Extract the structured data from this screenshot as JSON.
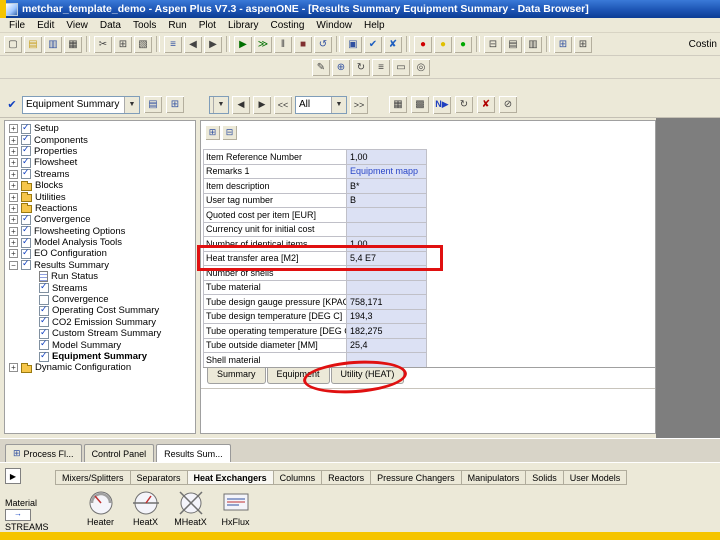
{
  "window": {
    "title": "metchar_template_demo - Aspen Plus V7.3 - aspenONE - [Results Summary Equipment Summary - Data Browser]"
  },
  "menu": {
    "items": [
      "File",
      "Edit",
      "View",
      "Data",
      "Tools",
      "Run",
      "Plot",
      "Library",
      "Costing",
      "Window",
      "Help"
    ]
  },
  "toolbar_main": {
    "overflow_label": "Costin",
    "icons": [
      {
        "name": "new-icon",
        "glyph": "▢"
      },
      {
        "name": "open-icon",
        "glyph": "▤",
        "color": "#c8a020"
      },
      {
        "name": "save-icon",
        "glyph": "▥",
        "color": "#3050a0"
      },
      {
        "name": "print-icon",
        "glyph": "▦",
        "color": "#404040"
      },
      {
        "name": "sep1"
      },
      {
        "name": "cut-icon",
        "glyph": "✂"
      },
      {
        "name": "copy-icon",
        "glyph": "⊞"
      },
      {
        "name": "paste-icon",
        "glyph": "▧"
      },
      {
        "name": "sep2"
      },
      {
        "name": "data-browser-icon",
        "glyph": "≡",
        "color": "#3050a0"
      },
      {
        "name": "prev-form-icon",
        "glyph": "◀"
      },
      {
        "name": "next-form-icon",
        "glyph": "▶"
      },
      {
        "name": "sep3"
      },
      {
        "name": "run-icon",
        "glyph": "▶",
        "color": "#007000"
      },
      {
        "name": "step-icon",
        "glyph": "≫",
        "color": "#007000"
      },
      {
        "name": "pause-icon",
        "glyph": "‖"
      },
      {
        "name": "stop-icon",
        "glyph": "■",
        "color": "#803030"
      },
      {
        "name": "reinitialize-icon",
        "glyph": "↺",
        "color": "#3050a0"
      },
      {
        "name": "sep4"
      },
      {
        "name": "control-panel-icon",
        "glyph": "▣",
        "color": "#3050a0"
      },
      {
        "name": "check-results-icon",
        "glyph": "✔",
        "color": "#2060c0"
      },
      {
        "name": "cancel-run-icon",
        "glyph": "✘",
        "color": "#2060c0"
      },
      {
        "name": "sep5"
      },
      {
        "name": "status-stop-icon",
        "glyph": "●",
        "color": "#d00000"
      },
      {
        "name": "status-wait-icon",
        "glyph": "●",
        "color": "#e0c000"
      },
      {
        "name": "status-go-icon",
        "glyph": "●",
        "color": "#00a800"
      },
      {
        "name": "sep6"
      },
      {
        "name": "flowsheet-icon",
        "glyph": "⊟"
      },
      {
        "name": "history-icon",
        "glyph": "▤"
      },
      {
        "name": "report-icon",
        "glyph": "▥"
      },
      {
        "name": "sep7"
      },
      {
        "name": "costing-grid-icon",
        "glyph": "⊞",
        "color": "#3050a0"
      },
      {
        "name": "summary-table-icon",
        "glyph": "⊞"
      }
    ]
  },
  "toolbar_secondary": {
    "icons": [
      {
        "name": "draw-icon",
        "glyph": "✎"
      },
      {
        "name": "insert-block-icon",
        "glyph": "⊕",
        "color": "#3050a0"
      },
      {
        "name": "rotate-icon",
        "glyph": "↻"
      },
      {
        "name": "align-icon",
        "glyph": "≡"
      },
      {
        "name": "annotate-icon",
        "glyph": "▭"
      },
      {
        "name": "zoom-icon",
        "glyph": "◎"
      }
    ]
  },
  "browser_bar": {
    "check_glyph": "✔",
    "selector_value": "Equipment Summary",
    "filter_value": "All",
    "prev_glyph": "◀",
    "next_glyph": "▶",
    "fast_prev": "<<",
    "fast_next": ">>",
    "next_required": "N▶",
    "icons_left": [
      {
        "name": "sheet-view-icon",
        "glyph": "▤",
        "color": "#3050a0"
      },
      {
        "name": "compare-view-icon",
        "glyph": "⊞",
        "color": "#3050a0"
      }
    ],
    "icons_right": [
      {
        "name": "input-form-icon",
        "glyph": "▦"
      },
      {
        "name": "results-form-icon",
        "glyph": "▩"
      },
      {
        "name": "reconcile-icon",
        "glyph": "↻"
      },
      {
        "name": "delete-icon",
        "glyph": "✘",
        "color": "#b00000"
      },
      {
        "name": "hide-icon",
        "glyph": "⊘"
      }
    ]
  },
  "tree": {
    "items": [
      {
        "label": "Setup",
        "icon": "check",
        "expand": "+"
      },
      {
        "label": "Components",
        "icon": "check",
        "expand": "+"
      },
      {
        "label": "Properties",
        "icon": "check",
        "expand": "+"
      },
      {
        "label": "Flowsheet",
        "icon": "check",
        "expand": "+"
      },
      {
        "label": "Streams",
        "icon": "check",
        "expand": "+"
      },
      {
        "label": "Blocks",
        "icon": "folder",
        "expand": "+"
      },
      {
        "label": "Utilities",
        "icon": "folder",
        "expand": "+"
      },
      {
        "label": "Reactions",
        "icon": "folder",
        "expand": "+"
      },
      {
        "label": "Convergence",
        "icon": "check",
        "expand": "+"
      },
      {
        "label": "Flowsheeting Options",
        "icon": "check",
        "expand": "+"
      },
      {
        "label": "Model Analysis Tools",
        "icon": "check",
        "expand": "+"
      },
      {
        "label": "EO Configuration",
        "icon": "check",
        "expand": "+"
      },
      {
        "label": "Results Summary",
        "icon": "check",
        "expand": "−"
      },
      {
        "label": "Run Status",
        "icon": "sheet",
        "indent": 1
      },
      {
        "label": "Streams",
        "icon": "check",
        "indent": 1
      },
      {
        "label": "Convergence",
        "icon": "empty",
        "indent": 1
      },
      {
        "label": "Operating Cost Summary",
        "icon": "check",
        "indent": 1
      },
      {
        "label": "CO2 Emission Summary",
        "icon": "check",
        "indent": 1
      },
      {
        "label": "Custom Stream Summary",
        "icon": "check",
        "indent": 1
      },
      {
        "label": "Model Summary",
        "icon": "check",
        "indent": 1
      },
      {
        "label": "Equipment Summary",
        "icon": "check",
        "indent": 1,
        "selected": true
      },
      {
        "label": "Dynamic Configuration",
        "icon": "folder",
        "expand": "+"
      }
    ]
  },
  "form": {
    "toolbar_icons": [
      {
        "name": "table-format-icon",
        "glyph": "⊞"
      },
      {
        "name": "stream-format-icon",
        "glyph": "⊟"
      }
    ],
    "table": {
      "rows": [
        {
          "label": "Item Reference Number",
          "value": "1,00"
        },
        {
          "label": "Remarks 1",
          "value": "Equipment mapp",
          "blue": true
        },
        {
          "label": "Item description",
          "value": "B*"
        },
        {
          "label": "User tag number",
          "value": "B"
        },
        {
          "label": "Quoted cost per item [EUR]",
          "value": ""
        },
        {
          "label": "Currency unit for initial cost",
          "value": ""
        },
        {
          "label": "Number of identical items",
          "value": "1,00"
        },
        {
          "label": "Heat transfer area [M2]",
          "value": "5,4 E7"
        },
        {
          "label": "Number of shells",
          "value": ""
        },
        {
          "label": "Tube material",
          "value": ""
        },
        {
          "label": "Tube design gauge pressure [KPAG]",
          "value": "758,171"
        },
        {
          "label": "Tube design temperature [DEG C]",
          "value": "194,3"
        },
        {
          "label": "Tube operating temperature [DEG C]",
          "value": "182,275"
        },
        {
          "label": "Tube outside diameter [MM]",
          "value": "25,4"
        },
        {
          "label": "Shell material",
          "value": ""
        }
      ]
    },
    "tabs": [
      "Summary",
      "Equipment",
      "Utility (HEAT)"
    ]
  },
  "annotations": {
    "highlighted_row": "Heat transfer area [M2]",
    "highlighted_value": "5,4 E7",
    "circled_tab": "Utility (HEAT)",
    "highlight_color": "#e01010"
  },
  "window_tabs": {
    "active": "Results Sum...",
    "items": [
      {
        "label": "Process Fl...",
        "icon": "flowsheet-tab-icon",
        "icon_glyph": "⊞"
      },
      {
        "label": "Control Panel"
      },
      {
        "label": "Results Sum..."
      }
    ]
  },
  "palette": {
    "pointer_glyph": "▶",
    "tabs": [
      "Mixers/Splitters",
      "Separators",
      "Heat Exchangers",
      "Columns",
      "Reactors",
      "Pressure Changers",
      "Manipulators",
      "Solids",
      "User Models"
    ],
    "active_tab": "Heat Exchangers",
    "streams": {
      "line1": "Material",
      "line2": "STREAMS",
      "icon_glyph": "→"
    },
    "models": [
      {
        "name": "Heater",
        "icon": "heater-icon"
      },
      {
        "name": "HeatX",
        "icon": "heatx-icon"
      },
      {
        "name": "MHeatX",
        "icon": "mheatx-icon"
      },
      {
        "name": "HxFlux",
        "icon": "hxflux-icon"
      }
    ]
  }
}
